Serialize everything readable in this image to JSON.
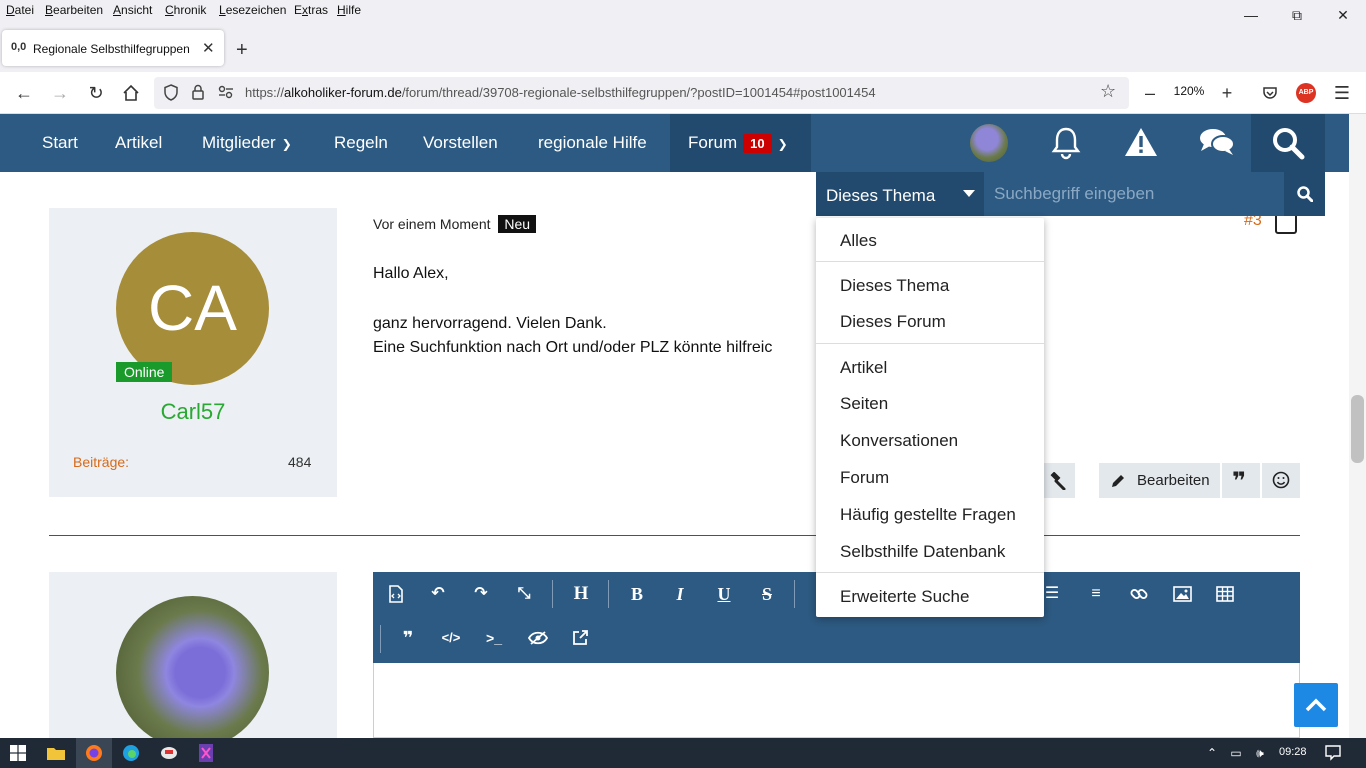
{
  "menubar": {
    "items": [
      "Datei",
      "Bearbeiten",
      "Ansicht",
      "Chronik",
      "Lesezeichen",
      "Extras",
      "Hilfe"
    ],
    "underline": [
      "D",
      "B",
      "A",
      "C",
      "L",
      "x",
      "H"
    ]
  },
  "tab": {
    "favicon": "0,0",
    "title": "Regionale Selbsthilfegruppen -",
    "close": "✕",
    "new_tab": "+"
  },
  "urlbar": {
    "scheme": "https://",
    "host": "alkoholiker-forum.de",
    "path": "/forum/thread/39708-regionale-selbsthilfegruppen/?postID=1001454#post1001454",
    "zoom": "120%",
    "abp": "ABP"
  },
  "site_nav": {
    "items": [
      "Start",
      "Artikel",
      "Mitglieder",
      "Regeln",
      "Vorstellen",
      "regionale Hilfe",
      "Forum"
    ],
    "forum_badge": "10"
  },
  "search": {
    "scope": "Dieses Thema",
    "placeholder": "Suchbegriff eingeben"
  },
  "dropdown": {
    "items": [
      "Alles",
      "Dieses Thema",
      "Dieses Forum",
      "Artikel",
      "Seiten",
      "Konversationen",
      "Forum",
      "Häufig gestellte Fragen",
      "Selbsthilfe Datenbank",
      "Erweiterte Suche"
    ]
  },
  "post": {
    "author_initials": "CA",
    "online_label": "Online",
    "author": "Carl57",
    "posts_label": "Beiträge:",
    "posts_count": "484",
    "time": "Vor einem Moment",
    "new_badge": "Neu",
    "number": "#3",
    "lines": [
      "Hallo Alex,",
      "ganz hervorragend. Vielen Dank.",
      "Eine Suchfunktion nach Ort und/oder PLZ könnte hilfreic"
    ],
    "edit_label": "Bearbeiten"
  },
  "editor": {
    "heading_btn": "H",
    "bold_btn": "B",
    "italic_btn": "I",
    "underline_btn": "U",
    "strike_btn": "S"
  },
  "taskbar": {
    "time": "09:28"
  },
  "colors": {
    "header": "#2d5a82",
    "header_dark": "#224a6e",
    "accent_orange": "#d76a1a",
    "online_green": "#1a9a2a",
    "badge_red": "#cc0000"
  }
}
